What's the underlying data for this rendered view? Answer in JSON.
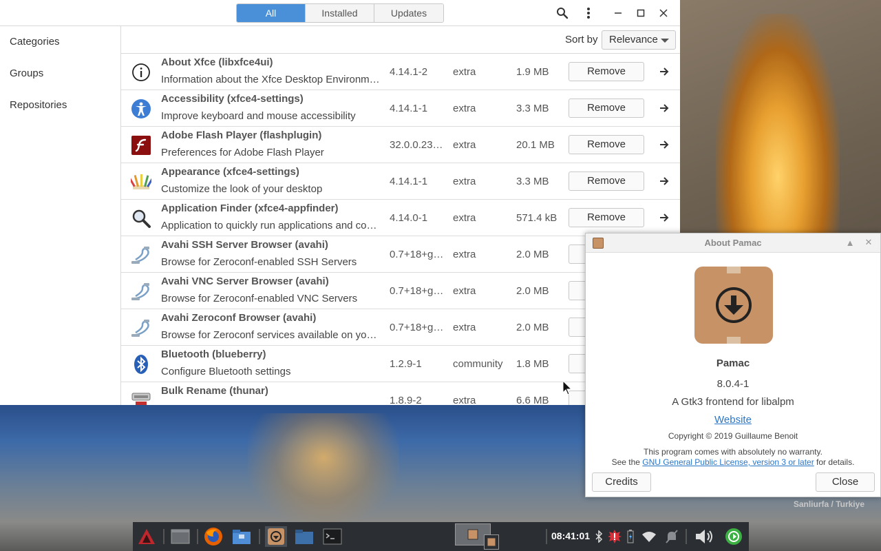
{
  "pamac": {
    "tabs": [
      {
        "label": "All"
      },
      {
        "label": "Installed"
      },
      {
        "label": "Updates"
      }
    ],
    "headerbar_icons": [
      "search-icon",
      "menu-icon",
      "minimize-icon",
      "maximize-icon",
      "close-icon"
    ],
    "sidebar": {
      "items": [
        {
          "label": "Categories"
        },
        {
          "label": "Groups"
        },
        {
          "label": "Repositories"
        }
      ]
    },
    "sort": {
      "label": "Sort by",
      "value": "Relevance"
    },
    "packages": [
      {
        "name": "About Xfce  (libxfce4ui)",
        "desc": "Information about the Xfce Desktop Environment",
        "version": "4.14.1-2",
        "repo": "extra",
        "size": "1.9 MB",
        "action": "Remove",
        "icon": "info-icon"
      },
      {
        "name": "Accessibility  (xfce4-settings)",
        "desc": "Improve keyboard and mouse accessibility",
        "version": "4.14.1-1",
        "repo": "extra",
        "size": "3.3 MB",
        "action": "Remove",
        "icon": "accessibility-icon"
      },
      {
        "name": "Adobe Flash Player  (flashplugin)",
        "desc": "Preferences for Adobe Flash Player",
        "version": "32.0.0.23…",
        "repo": "extra",
        "size": "20.1 MB",
        "action": "Remove",
        "icon": "flash-icon"
      },
      {
        "name": "Appearance  (xfce4-settings)",
        "desc": "Customize the look of your desktop",
        "version": "4.14.1-1",
        "repo": "extra",
        "size": "3.3 MB",
        "action": "Remove",
        "icon": "appearance-icon"
      },
      {
        "name": "Application Finder  (xfce4-appfinder)",
        "desc": "Application to quickly run applications and com…",
        "version": "4.14.0-1",
        "repo": "extra",
        "size": "571.4 kB",
        "action": "Remove",
        "icon": "magnifier-icon"
      },
      {
        "name": "Avahi SSH Server Browser  (avahi)",
        "desc": "Browse for Zeroconf-enabled SSH Servers",
        "version": "0.7+18+g…",
        "repo": "extra",
        "size": "2.0 MB",
        "action": "",
        "icon": "avahi-icon"
      },
      {
        "name": "Avahi VNC Server Browser  (avahi)",
        "desc": "Browse for Zeroconf-enabled VNC Servers",
        "version": "0.7+18+g…",
        "repo": "extra",
        "size": "2.0 MB",
        "action": "",
        "icon": "avahi-icon"
      },
      {
        "name": "Avahi Zeroconf Browser  (avahi)",
        "desc": "Browse for Zeroconf services available on your …",
        "version": "0.7+18+g…",
        "repo": "extra",
        "size": "2.0 MB",
        "action": "",
        "icon": "avahi-icon"
      },
      {
        "name": "Bluetooth  (blueberry)",
        "desc": "Configure Bluetooth settings",
        "version": "1.2.9-1",
        "repo": "community",
        "size": "1.8 MB",
        "action": "",
        "icon": "bluetooth-icon"
      },
      {
        "name": "Bulk Rename  (thunar)",
        "desc": "",
        "version": "1.8.9-2",
        "repo": "extra",
        "size": "6.6 MB",
        "action": "",
        "icon": "bulk-rename-icon"
      }
    ]
  },
  "about": {
    "title": "About Pamac",
    "app_name": "Pamac",
    "version": "8.0.4-1",
    "comment": "A Gtk3 frontend for libalpm",
    "website": "Website",
    "copyright": "Copyright © 2019 Guillaume Benoit",
    "warranty_line1": "This program comes with absolutely no warranty.",
    "warranty_pre": "See the ",
    "license_link": "GNU General Public License, version 3 or later",
    "warranty_post": " for details.",
    "credits": "Credits",
    "close": "Close"
  },
  "desktop": {
    "caption": "Sanliurfa / Turkiye"
  },
  "taskbar": {
    "clock": "08:41:01"
  }
}
